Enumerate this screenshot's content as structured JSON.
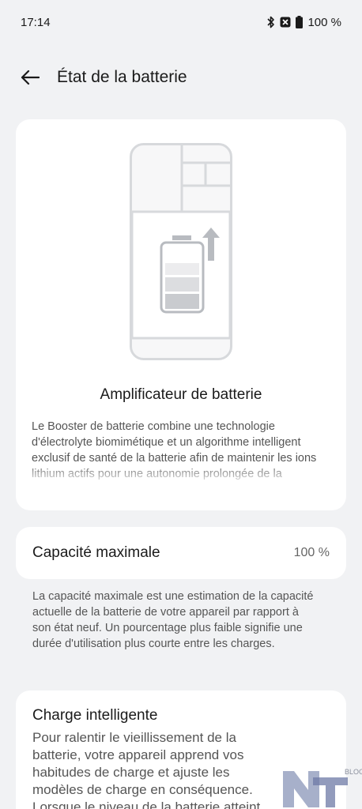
{
  "status_bar": {
    "time": "17:14",
    "battery": "100 %",
    "icons": [
      "bluetooth-icon",
      "nfc-icon",
      "battery-icon"
    ]
  },
  "app_bar": {
    "title": "État de la batterie",
    "back_icon": "back-arrow-icon"
  },
  "booster": {
    "title": "Amplificateur de batterie",
    "description": "Le Booster de batterie combine une technologie d'électrolyte biomimétique et un algorithme intelligent exclusif de santé de la batterie afin de maintenir les ions lithium actifs pour une autonomie prolongée de la"
  },
  "capacity": {
    "label": "Capacité maximale",
    "value": "100 %",
    "note": "La capacité maximale est une estimation de la capacité actuelle de la batterie de votre appareil par rapport à son état neuf. Un pourcentage plus faible signifie une durée d'utilisation plus courte entre les charges."
  },
  "smart_charge": {
    "title": "Charge intelligente",
    "description": "Pour ralentir le vieillissement de la batterie, votre appareil apprend vos habitudes de charge et ajuste les modèles de charge en conséquence. Lorsque le niveau de la batterie atteint"
  },
  "watermark": {
    "text": "BLOG"
  }
}
